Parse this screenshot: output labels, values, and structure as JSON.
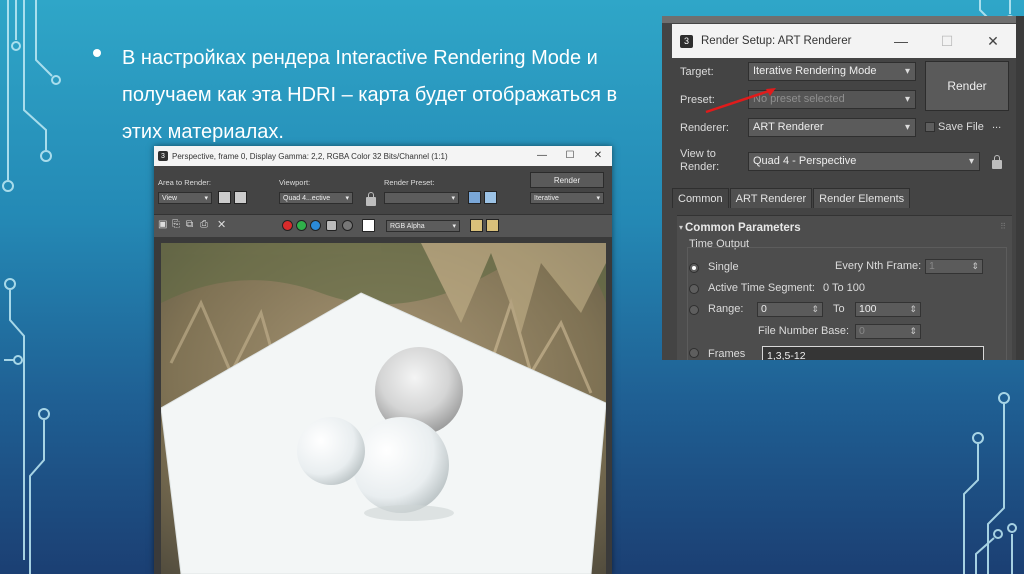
{
  "slide": {
    "bullet_text": "В настройках рендера Interactive Rendering Mode и получаем как эта HDRI – карта будет отображаться в этих материалах."
  },
  "frame_buffer": {
    "title": "Perspective, frame 0, Display Gamma: 2,2, RGBA Color 32 Bits/Channel (1:1)",
    "area_label": "Area to Render:",
    "area_value": "View",
    "viewport_label": "Viewport:",
    "viewport_value": "Quad 4...ective",
    "preset_label": "Render Preset:",
    "preset_value": "",
    "render_button": "Render",
    "mode_value": "Iterative",
    "channel_value": "RGB Alpha",
    "channel_colors": [
      "#d92b2b",
      "#2fb04a",
      "#2b8ad9"
    ]
  },
  "render_setup": {
    "title": "Render Setup: ART Renderer",
    "target_label": "Target:",
    "target_value": "Iterative Rendering Mode",
    "preset_label": "Preset:",
    "preset_value": "No preset selected",
    "renderer_label": "Renderer:",
    "renderer_value": "ART Renderer",
    "save_file_label": "Save File",
    "more_label": "...",
    "view_label_line1": "View to",
    "view_label_line2": "Render:",
    "view_value": "Quad 4 - Perspective",
    "render_button": "Render",
    "tabs": [
      "Common",
      "ART Renderer",
      "Render Elements"
    ],
    "panel_title": "Common Parameters",
    "group_title": "Time Output",
    "single_label": "Single",
    "every_nth_label": "Every Nth Frame:",
    "every_nth_value": "1",
    "active_segment_label": "Active Time Segment:",
    "active_segment_value": "0 To 100",
    "range_label": "Range:",
    "range_from": "0",
    "range_to_label": "To",
    "range_to": "100",
    "file_number_base_label": "File Number Base:",
    "file_number_base_value": "0",
    "frames_label": "Frames",
    "frames_value": "1,3,5-12"
  }
}
